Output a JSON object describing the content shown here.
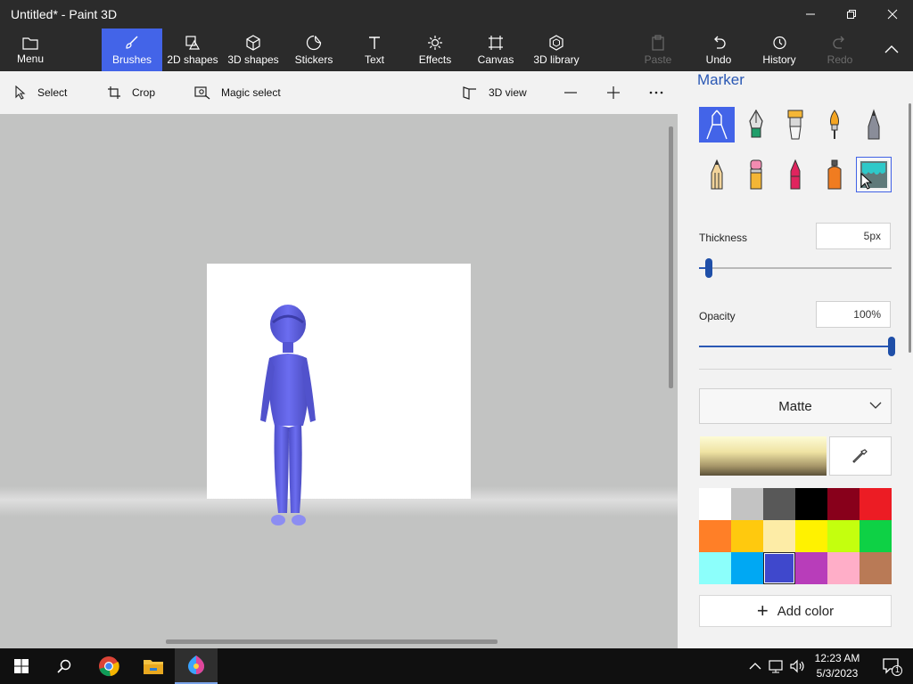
{
  "window": {
    "title": "Untitled* - Paint 3D"
  },
  "ribbon": {
    "menu": "Menu",
    "brushes": "Brushes",
    "shapes2d": "2D shapes",
    "shapes3d": "3D shapes",
    "stickers": "Stickers",
    "text": "Text",
    "effects": "Effects",
    "canvas": "Canvas",
    "library3d": "3D library",
    "paste": "Paste",
    "undo": "Undo",
    "history": "History",
    "redo": "Redo"
  },
  "toolbar": {
    "select": "Select",
    "crop": "Crop",
    "magic_select": "Magic select",
    "view3d": "3D view"
  },
  "panel": {
    "title": "Marker",
    "brushes": [
      "marker",
      "calligraphy-pen",
      "oil-brush",
      "watercolor",
      "pixel-pen",
      "pencil",
      "eraser",
      "crayon",
      "spray-can",
      "fill"
    ],
    "selected_brush": "marker",
    "thickness_label": "Thickness",
    "thickness_value": "5px",
    "thickness_fraction": 0.05,
    "opacity_label": "Opacity",
    "opacity_value": "100%",
    "opacity_fraction": 1.0,
    "finish": "Matte",
    "add_color": "Add color",
    "palette": [
      "#ffffff",
      "#c3c3c3",
      "#585858",
      "#000000",
      "#88001b",
      "#ec1c24",
      "#ff7f27",
      "#ffc90e",
      "#fdeca6",
      "#fff200",
      "#c4ff0e",
      "#0ed145",
      "#8cfffb",
      "#00a8f3",
      "#3f48cc",
      "#b83dba",
      "#ffaec8",
      "#b97a56"
    ],
    "selected_color": "#3f48cc"
  },
  "taskbar": {
    "time": "12:23 AM",
    "date": "5/3/2023",
    "notifications": "1"
  }
}
